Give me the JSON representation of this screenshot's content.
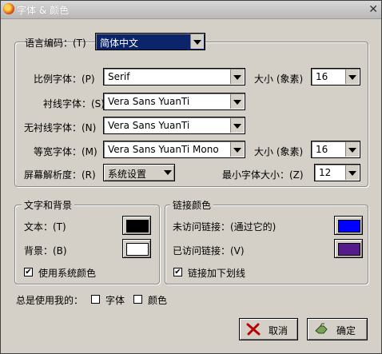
{
  "window": {
    "title": "字体 & 颜色"
  },
  "fonts_group": {
    "language_label": "语言编码：(T)",
    "language_value": "简体中文",
    "proportional_label": "比例字体：(P)",
    "proportional_value": "Serif",
    "proportional_size_label": "大小 (象素)",
    "proportional_size_value": "16",
    "serif_label": "衬线字体：(S)",
    "serif_value": "Vera Sans YuanTi",
    "sans_label": "无衬线字体：(N)",
    "sans_value": "Vera Sans YuanTi",
    "mono_label": "等宽字体：(M)",
    "mono_value": "Vera Sans YuanTi Mono",
    "mono_size_label": "大小 (象素)",
    "mono_size_value": "16",
    "resolution_label": "屏幕解析度：(R)",
    "resolution_value": "系统设置",
    "min_size_label": "最小字体大小：(Z)",
    "min_size_value": "12"
  },
  "text_bg_group": {
    "title": "文字和背景",
    "text_label": "文本：(T)",
    "text_color": "#000000",
    "bg_label": "背景：(B)",
    "bg_color": "#ffffff",
    "use_system_label": "使用系统颜色",
    "use_system_checked": true
  },
  "link_group": {
    "title": "链接颜色",
    "unvisited_label": "未访问链接：(通过它的)",
    "unvisited_color": "#0000ff",
    "visited_label": "已访问链接：(V)",
    "visited_color": "#551a8b",
    "underline_label": "链接加下划线",
    "underline_checked": true
  },
  "always_use": {
    "label": "总是使用我的：",
    "fonts_label": "字体",
    "fonts_checked": false,
    "colors_label": "颜色",
    "colors_checked": false
  },
  "buttons": {
    "cancel": "取消",
    "ok": "确定"
  }
}
